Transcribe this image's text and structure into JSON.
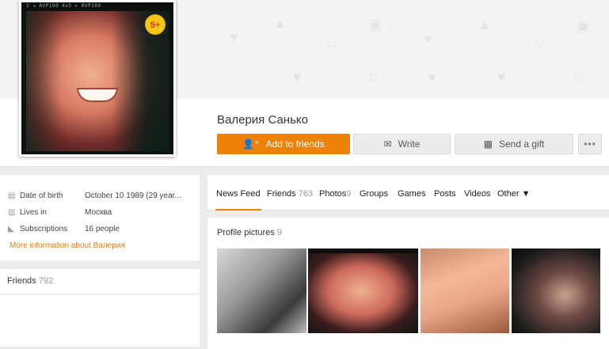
{
  "profile": {
    "name": "Валерия Санько",
    "age_badge": "5+",
    "avatar_strip": "2  ◂  RVP100        4x5      ▸  RVP100"
  },
  "actions": {
    "add_friends": "Add to friends",
    "write": "Write",
    "send_gift": "Send a gift",
    "more": "•••"
  },
  "info": {
    "birth_label": "Date of birth",
    "birth_value": "October 10 1989 (29 year...",
    "lives_label": "Lives in",
    "lives_value": "Москва",
    "subs_label": "Subscriptions",
    "subs_value": "16 people",
    "more_link": "More information about Валерия"
  },
  "friends_card": {
    "label": "Friends",
    "count": "792"
  },
  "tabs": [
    {
      "label": "News Feed",
      "count": ""
    },
    {
      "label": "Friends",
      "count": "763"
    },
    {
      "label": "Photos",
      "count": "9"
    },
    {
      "label": "Groups",
      "count": ""
    },
    {
      "label": "Games",
      "count": ""
    },
    {
      "label": "Posts",
      "count": ""
    },
    {
      "label": "Videos",
      "count": ""
    },
    {
      "label": "Other ▼",
      "count": ""
    }
  ],
  "photos": {
    "title": "Profile pictures",
    "count": "9"
  },
  "colors": {
    "accent": "#ee8208",
    "link": "#eb7a12"
  },
  "icons": {
    "add": "add-user-icon",
    "write": "envelope-icon",
    "gift": "gift-icon",
    "birth": "calendar-icon",
    "lives": "building-icon",
    "subs": "rss-icon"
  }
}
